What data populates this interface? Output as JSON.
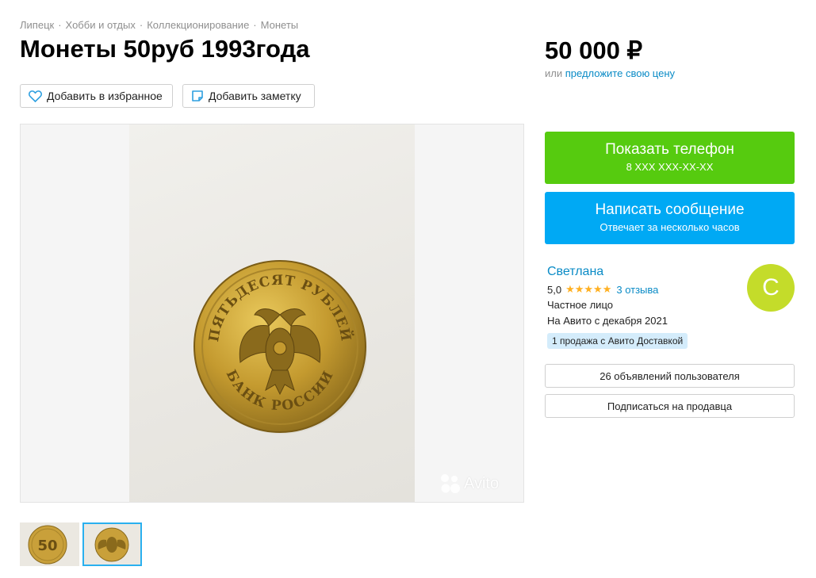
{
  "breadcrumb": [
    "Липецк",
    "Хобби и отдых",
    "Коллекционирование",
    "Монеты"
  ],
  "title": "Монеты 50руб 1993года",
  "actions": {
    "favorite_label": "Добавить в избранное",
    "note_label": "Добавить заметку"
  },
  "price": {
    "amount": "50 000 ₽",
    "or_text": "или",
    "offer_link": "предложите свою цену"
  },
  "gallery": {
    "watermark": "Avito",
    "coin_inscription_top": "ПЯТЬДЕСЯТ РУБЛЕЙ",
    "coin_inscription_bottom": "БАНК РОССИИ",
    "thumb1_number": "50",
    "selected_thumbnail": 2
  },
  "phone_button": {
    "label": "Показать телефон",
    "number": "8 XXX XXX-XX-XX"
  },
  "message_button": {
    "label": "Написать сообщение",
    "subtitle": "Отвечает за несколько часов"
  },
  "seller": {
    "name": "Светлана",
    "rating": "5,0",
    "stars": "★★★★★",
    "reviews": "3 отзыва",
    "type": "Частное лицо",
    "since": "На Авито с декабря 2021",
    "badge": "1 продажа с Авито Доставкой",
    "avatar_letter": "С"
  },
  "seller_links": {
    "ads": "26 объявлений пользователя",
    "subscribe": "Подписаться на продавца"
  },
  "colors": {
    "phone_button": "#56cb0f",
    "message_button": "#00a9f4",
    "link": "#0a8bc6",
    "star": "#ffb021",
    "avatar": "#c4dc2a",
    "badge": "#d4ecfb"
  }
}
